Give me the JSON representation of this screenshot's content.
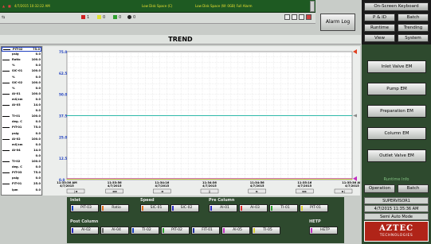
{
  "alarm_banner": {
    "timestamp_text": "4/7/2015 10:32:22 AM",
    "messages": [
      "Low Disk Space (C)",
      "Low Disk Space (W: 0GB) Full Alarm"
    ]
  },
  "status_bar": {
    "count_a": "1",
    "count_b": "0",
    "count_c": "0",
    "count_d": "0"
  },
  "alarm_log_label": "Alarm Log",
  "nav": {
    "on_screen_keyboard": "On-Screen Keyboard",
    "p_and_id": "P & ID",
    "batch": "Batch",
    "runtime": "Runtime",
    "trending": "Trending",
    "view": "View",
    "system": "System"
  },
  "em_buttons": [
    "Inlet Valve EM",
    "Pump EM",
    "Preparation EM",
    "Column EM",
    "Outlet Valve EM"
  ],
  "runtime_info_label": "Runtime Info",
  "mode_buttons": {
    "operation": "Operation",
    "batch": "Batch"
  },
  "user": {
    "name": "SUPERVISOR1",
    "datetime": "4/7/2015 11:35:36 AM",
    "mode": "Semi Auto Mode"
  },
  "logo": {
    "title": "AZTEC",
    "subtitle": "TECHNOLOGIES"
  },
  "trend_title": "TREND",
  "tags": [
    {
      "name": "PIT-02",
      "value": "75.0",
      "color": "#000000"
    },
    {
      "name": "psig",
      "value": "0.0",
      "color": ""
    },
    {
      "name": "Ratio",
      "value": "100.0",
      "color": "#000000"
    },
    {
      "name": "%",
      "value": "0.0",
      "color": ""
    },
    {
      "name": "SIC-01",
      "value": "100.0",
      "color": "#000000"
    },
    {
      "name": "%",
      "value": "0.0",
      "color": ""
    },
    {
      "name": "SIC-02",
      "value": "100.0",
      "color": "#000000"
    },
    {
      "name": "%",
      "value": "0.0",
      "color": ""
    },
    {
      "name": "AI-01",
      "value": "100.0",
      "color": "#000000"
    },
    {
      "name": "mS/cm",
      "value": "0.0",
      "color": ""
    },
    {
      "name": "AI-03",
      "value": "14.0",
      "color": "#000000"
    },
    {
      "name": "",
      "value": "0.0",
      "color": ""
    },
    {
      "name": "TI-01",
      "value": "100.0",
      "color": "#000000"
    },
    {
      "name": "deg. C",
      "value": "0.0",
      "color": ""
    },
    {
      "name": "PIT-01",
      "value": "75.0",
      "color": "#000000"
    },
    {
      "name": "psig",
      "value": "0.0",
      "color": ""
    },
    {
      "name": "AI-02",
      "value": "100.0",
      "color": "#000000"
    },
    {
      "name": "mS/cm",
      "value": "0.0",
      "color": ""
    },
    {
      "name": "AI-04",
      "value": "14.0",
      "color": "#000000"
    },
    {
      "name": "",
      "value": "0.0",
      "color": ""
    },
    {
      "name": "TI-02",
      "value": "100.0",
      "color": "#000000"
    },
    {
      "name": "deg. C",
      "value": "0.0",
      "color": ""
    },
    {
      "name": "PIT-03",
      "value": "75.0",
      "color": "#000000"
    },
    {
      "name": "psig",
      "value": "0.0",
      "color": ""
    },
    {
      "name": "FIT-01",
      "value": "25.0",
      "color": "#000000"
    },
    {
      "name": "lpm",
      "value": "0.0",
      "color": ""
    }
  ],
  "chart_data": {
    "type": "line",
    "ylim": [
      0,
      75
    ],
    "y_ticks": [
      "75.0",
      "62.5",
      "50.0",
      "37.5",
      "25.0",
      "12.5",
      "0.0"
    ],
    "x_ticks": [
      {
        "time": "11:33:36 AM",
        "date": "4/7/2015"
      },
      {
        "time": "11:33:56",
        "date": "4/7/2015"
      },
      {
        "time": "11:34:16",
        "date": "4/7/2015"
      },
      {
        "time": "11:34:36",
        "date": "4/7/2015"
      },
      {
        "time": "11:34:56",
        "date": "4/7/2015"
      },
      {
        "time": "11:35:16",
        "date": "4/7/2015"
      },
      {
        "time": "11:35:36 AM",
        "date": "4/7/2015"
      }
    ],
    "series": [
      {
        "color": "#2fb8a8",
        "values": [
          37.5,
          37.5,
          37.5,
          37.5,
          37.5,
          37.5,
          37.5
        ]
      },
      {
        "color": "#c030c0",
        "values": [
          0.6,
          0.6,
          0.6,
          0.6,
          0.6,
          0.6,
          0.6
        ]
      },
      {
        "color": "#d8d830",
        "values": [
          0.3,
          0.3,
          0.3,
          0.3,
          0.3,
          0.3,
          0.3
        ]
      }
    ],
    "grid": true
  },
  "scroll_buttons": [
    "|◄",
    "◄◄",
    "◄",
    "||",
    "►",
    "►►",
    "►|"
  ],
  "groups": {
    "inlet": {
      "label": "Inlet",
      "items": [
        {
          "name": "PIT-03",
          "color": "#1840c0"
        },
        {
          "name": "Ratio",
          "color": "#e07020"
        }
      ]
    },
    "speed": {
      "label": "Speed",
      "items": [
        {
          "name": "SIC-01",
          "color": "#e07020"
        },
        {
          "name": "SIC-02",
          "color": "#2a2ac0"
        }
      ]
    },
    "pre_column": {
      "label": "Pre Column",
      "items": [
        {
          "name": "AI-01",
          "color": "#2a2ac0"
        },
        {
          "name": "AI-03",
          "color": "#e03030"
        },
        {
          "name": "TI-01",
          "color": "#30a030"
        },
        {
          "name": "PIT-01",
          "color": "#d8d030"
        }
      ]
    },
    "post_column": {
      "label": "Post Column",
      "items": [
        {
          "name": "AI-02",
          "color": "#2a2ac0"
        },
        {
          "name": "AI-04",
          "color": "#ffffff"
        },
        {
          "name": "TI-02",
          "color": "#1840c0"
        },
        {
          "name": "PIT-02",
          "color": "#30a030"
        },
        {
          "name": "FIT-01",
          "color": "#2030a0"
        },
        {
          "name": "AI-05",
          "color": "#c030c0"
        },
        {
          "name": "TI-05",
          "color": "#d8d030"
        }
      ]
    },
    "hetp": {
      "label": "HETP",
      "items": [
        {
          "name": "HETP",
          "color": "#c030c0"
        }
      ]
    }
  }
}
